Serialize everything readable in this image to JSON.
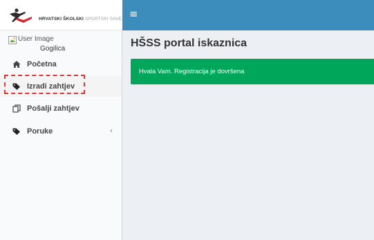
{
  "brand": {
    "text_strong": "HRVATSKI ŠKOLSKI",
    "text_light": "SPORTSKI SAVEZ"
  },
  "topbar": {
    "menu_icon": "hamburger-icon"
  },
  "user_panel": {
    "image_alt": "User Image",
    "name": "Gogilica"
  },
  "sidebar": {
    "items": [
      {
        "label": "Početna",
        "icon": "home-icon"
      },
      {
        "label": "Izradi zahtjev",
        "icon": "tag-icon",
        "active": true
      },
      {
        "label": "Pošalji zahtjev",
        "icon": "copy-icon"
      },
      {
        "label": "Poruke",
        "icon": "tag-icon",
        "has_submenu": true,
        "chevron": "‹"
      }
    ]
  },
  "main": {
    "title": "HŠSS portal iskaznica",
    "alert": {
      "message": "Hvala Vam. Registracija je dovršena",
      "color": "#00a65a"
    }
  },
  "colors": {
    "topbar": "#3c8dbc",
    "sidebar_bg": "#f9fafc",
    "content_bg": "#ecf0f5",
    "highlight": "#e03030"
  }
}
